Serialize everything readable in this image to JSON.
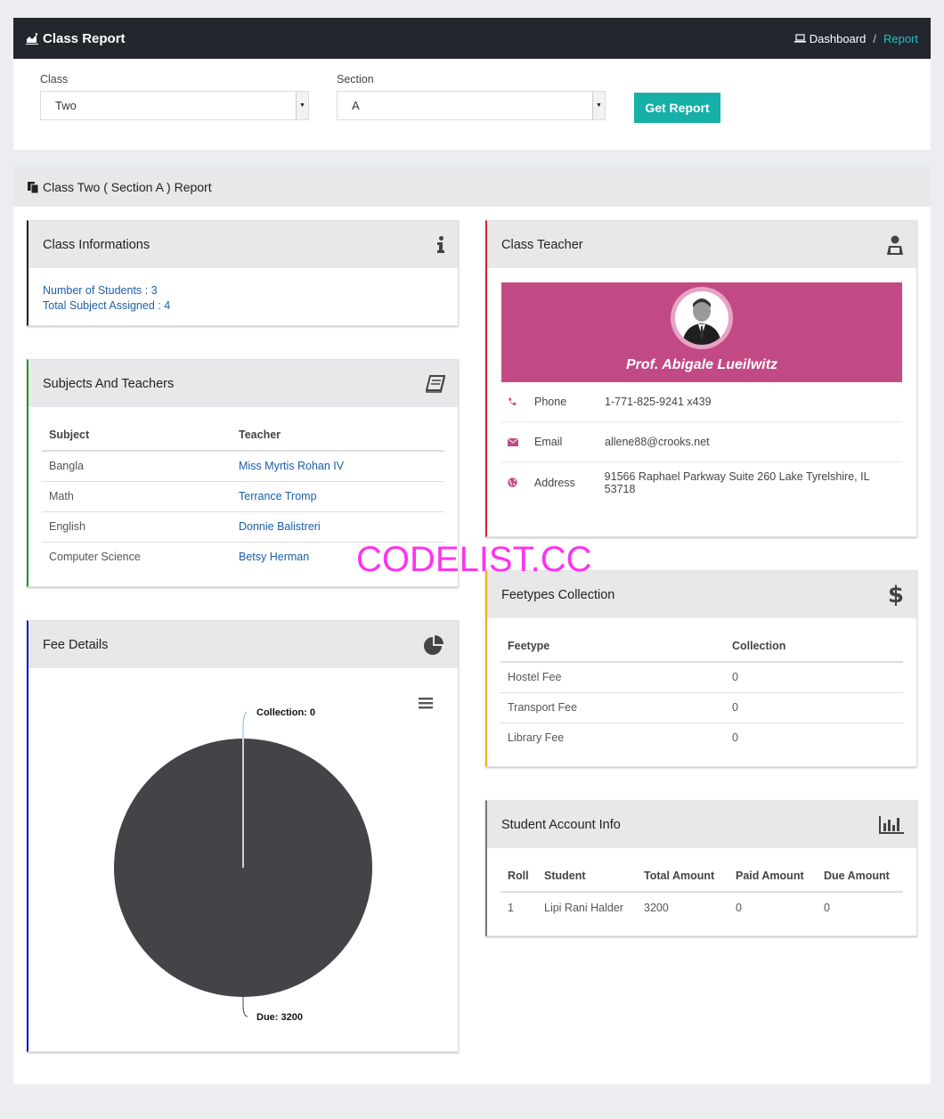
{
  "header": {
    "title": "Class Report",
    "breadcrumb_home": "Dashboard",
    "breadcrumb_sep": "/",
    "breadcrumb_current": "Report"
  },
  "filters": {
    "class_label": "Class",
    "class_value": "Two",
    "section_label": "Section",
    "section_value": "A",
    "submit_label": "Get Report"
  },
  "report": {
    "title": "Class Two ( Section A ) Report"
  },
  "class_info": {
    "title": "Class Informations",
    "students": "Number of Students : 3",
    "subjects": "Total Subject Assigned : 4"
  },
  "subjects": {
    "title": "Subjects And Teachers",
    "columns": [
      "Subject",
      "Teacher"
    ],
    "rows": [
      {
        "subject": "Bangla",
        "teacher": "Miss Myrtis Rohan IV"
      },
      {
        "subject": "Math",
        "teacher": "Terrance Tromp"
      },
      {
        "subject": "English",
        "teacher": "Donnie Balistreri"
      },
      {
        "subject": "Computer Science",
        "teacher": "Betsy Herman"
      }
    ]
  },
  "fee_details": {
    "title": "Fee Details",
    "menu_icon": "hamburger-icon"
  },
  "chart_data": {
    "type": "pie",
    "categories": [
      "Collection",
      "Due"
    ],
    "values": [
      0,
      3200
    ],
    "labels": [
      "Collection: 0",
      "Due: 3200"
    ],
    "colors": [
      "#7cb5ec",
      "#434348"
    ]
  },
  "class_teacher": {
    "title": "Class Teacher",
    "name": "Prof. Abigale Lueilwitz",
    "phone_label": "Phone",
    "phone": "1-771-825-9241 x439",
    "email_label": "Email",
    "email": "allene88@crooks.net",
    "address_label": "Address",
    "address": "91566 Raphael Parkway Suite 260 Lake Tyrelshire, IL 53718"
  },
  "feetypes": {
    "title": "Feetypes Collection",
    "columns": [
      "Feetype",
      "Collection"
    ],
    "rows": [
      {
        "feetype": "Hostel Fee",
        "collection": "0"
      },
      {
        "feetype": "Transport Fee",
        "collection": "0"
      },
      {
        "feetype": "Library Fee",
        "collection": "0"
      }
    ]
  },
  "student_account": {
    "title": "Student Account Info",
    "columns": [
      "Roll",
      "Student",
      "Total Amount",
      "Paid Amount",
      "Due Amount"
    ],
    "rows": [
      {
        "roll": "1",
        "student": "Lipi Rani Halder",
        "total": "3200",
        "paid": "0",
        "due": "0"
      }
    ]
  },
  "watermark": "CODELIST.CC",
  "colors": {
    "topbar": "#23262e",
    "accent": "#17b0a9",
    "teacher_card": "#c24a84",
    "link": "#1a5fa5",
    "panel_class_info": "#222222",
    "panel_subjects": "#1a9a2a",
    "panel_fee": "#1a1adb",
    "panel_teacher": "#d9232f",
    "panel_feetypes": "#f0b21a",
    "panel_account": "#777777"
  }
}
